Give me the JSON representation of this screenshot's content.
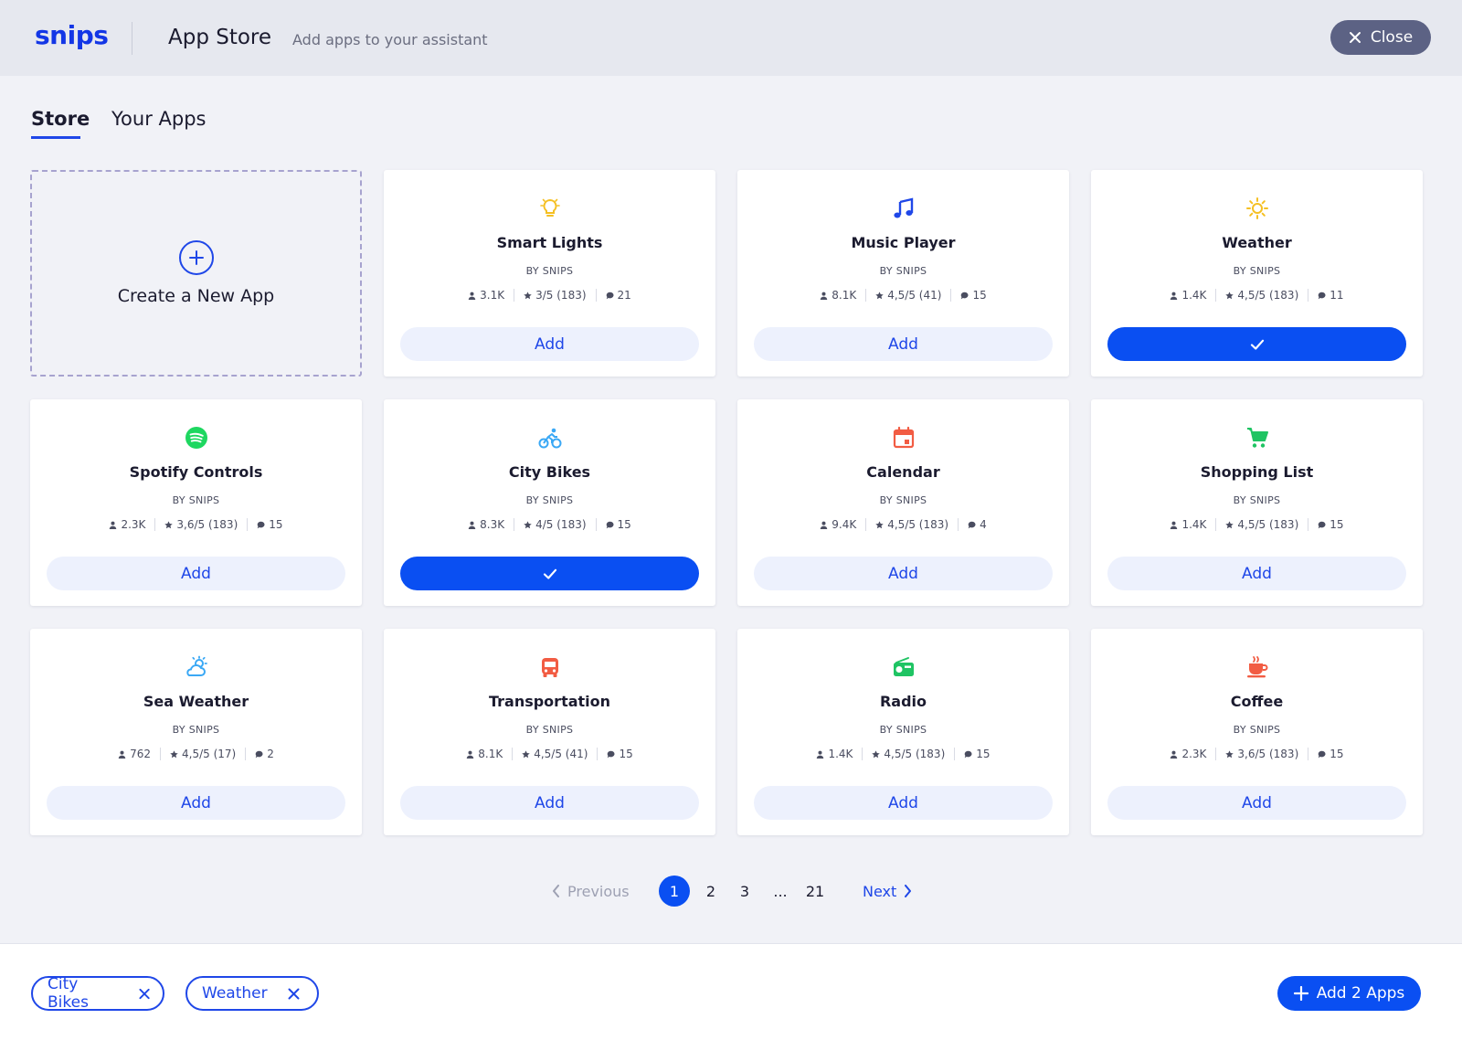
{
  "header": {
    "logo": "snips",
    "title": "App Store",
    "subtitle": "Add apps to your assistant",
    "close_label": "Close"
  },
  "tabs": [
    {
      "label": "Store",
      "active": true
    },
    {
      "label": "Your Apps",
      "active": false
    }
  ],
  "create_card": {
    "label": "Create a New App"
  },
  "apps": [
    {
      "name": "Smart Lights",
      "by": "BY SNIPS",
      "users": "3.1K",
      "rating": "3/5 (183)",
      "comments": "21",
      "icon": "lightbulb-icon",
      "icon_color": "#f5c023",
      "button": "Add",
      "added": false
    },
    {
      "name": "Music Player",
      "by": "BY SNIPS",
      "users": "8.1K",
      "rating": "4,5/5 (41)",
      "comments": "15",
      "icon": "music-note-icon",
      "icon_color": "#1f47e8",
      "button": "Add",
      "added": false
    },
    {
      "name": "Weather",
      "by": "BY SNIPS",
      "users": "1.4K",
      "rating": "4,5/5 (183)",
      "comments": "11",
      "icon": "sun-icon",
      "icon_color": "#f5c023",
      "button": "",
      "added": true
    },
    {
      "name": "Spotify Controls",
      "by": "BY SNIPS",
      "users": "2.3K",
      "rating": "3,6/5 (183)",
      "comments": "15",
      "icon": "spotify-icon",
      "icon_color": "#1ed760",
      "button": "Add",
      "added": false
    },
    {
      "name": "City Bikes",
      "by": "BY SNIPS",
      "users": "8.3K",
      "rating": "4/5 (183)",
      "comments": "15",
      "icon": "bike-icon",
      "icon_color": "#3aa8f5",
      "button": "",
      "added": true
    },
    {
      "name": "Calendar",
      "by": "BY SNIPS",
      "users": "9.4K",
      "rating": "4,5/5 (183)",
      "comments": "4",
      "icon": "calendar-icon",
      "icon_color": "#f25c43",
      "button": "Add",
      "added": false
    },
    {
      "name": "Shopping List",
      "by": "BY SNIPS",
      "users": "1.4K",
      "rating": "4,5/5 (183)",
      "comments": "15",
      "icon": "cart-icon",
      "icon_color": "#1fc463",
      "button": "Add",
      "added": false
    },
    {
      "name": "Sea Weather",
      "by": "BY SNIPS",
      "users": "762",
      "rating": "4,5/5 (17)",
      "comments": "2",
      "icon": "cloud-sun-icon",
      "icon_color": "#3aa8f5",
      "button": "Add",
      "added": false
    },
    {
      "name": "Transportation",
      "by": "BY SNIPS",
      "users": "8.1K",
      "rating": "4,5/5 (41)",
      "comments": "15",
      "icon": "bus-icon",
      "icon_color": "#f25c43",
      "button": "Add",
      "added": false
    },
    {
      "name": "Radio",
      "by": "BY SNIPS",
      "users": "1.4K",
      "rating": "4,5/5 (183)",
      "comments": "15",
      "icon": "radio-icon",
      "icon_color": "#1fc463",
      "button": "Add",
      "added": false
    },
    {
      "name": "Coffee",
      "by": "BY SNIPS",
      "users": "2.3K",
      "rating": "3,6/5 (183)",
      "comments": "15",
      "icon": "coffee-icon",
      "icon_color": "#f25c43",
      "button": "Add",
      "added": false
    }
  ],
  "pagination": {
    "previous": "Previous",
    "pages": [
      "1",
      "2",
      "3",
      "...",
      "21"
    ],
    "current": "1",
    "next": "Next"
  },
  "footer": {
    "selected": [
      "City Bikes",
      "Weather"
    ],
    "add_button": "Add 2 Apps"
  },
  "colors": {
    "accent": "#0a4ff2",
    "brand": "#1336e6",
    "close_bg": "#5c6284"
  }
}
